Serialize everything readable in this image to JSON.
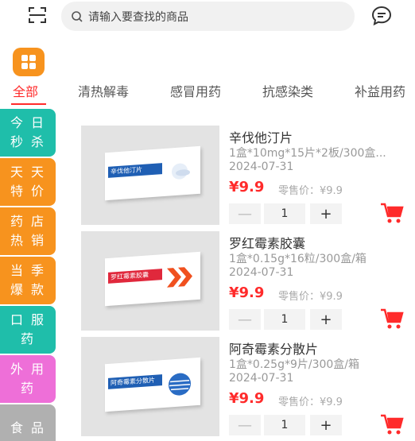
{
  "search": {
    "placeholder": "请输入要查找的商品"
  },
  "tabs": [
    {
      "label": "全部",
      "active": true
    },
    {
      "label": "清热解毒"
    },
    {
      "label": "感冒用药"
    },
    {
      "label": "抗感染类"
    },
    {
      "label": "补益用药"
    }
  ],
  "sidebar": [
    {
      "label": "今日秒杀",
      "color": "#1fbeaa"
    },
    {
      "label": "天天特价",
      "color": "#f7931e"
    },
    {
      "label": "药店热销",
      "color": "#f7931e"
    },
    {
      "label": "当季爆款",
      "color": "#f7931e"
    },
    {
      "label": "口服药",
      "color": "#1fbeaa"
    },
    {
      "label": "外用药",
      "color": "#ee6fd8"
    },
    {
      "label": "食品",
      "color": "#b0b0b0"
    }
  ],
  "products": [
    {
      "name": "辛伐他汀片",
      "spec": "1盒*10mg*15片*2板/300盒...",
      "date": "2024-07-31",
      "price": "¥9.9",
      "retail": "零售价：¥9.9",
      "qty": "1",
      "box_label": "辛伐他汀片",
      "box_color": "#1f5fb4"
    },
    {
      "name": "罗红霉素胶囊",
      "spec": "1盒*0.15g*16粒/300盒/箱",
      "date": "2024-07-31",
      "price": "¥9.9",
      "retail": "零售价：¥9.9",
      "qty": "1",
      "box_label": "罗红霉素胶囊",
      "box_color": "#e0283c"
    },
    {
      "name": "阿奇霉素分散片",
      "spec": "1盒*0.25g*9片/300盒/箱",
      "date": "2024-07-31",
      "price": "¥9.9",
      "retail": "零售价：¥9.9",
      "qty": "1",
      "box_label": "阿奇霉素分散片",
      "box_color": "#1f5fb4"
    }
  ],
  "colors": {
    "accent": "#ff2b2b",
    "category_icon": "#f7931e"
  },
  "icons": {
    "scan": "scan-icon",
    "search": "search-icon",
    "message": "message-icon",
    "category": "grid-icon",
    "cart": "cart-icon"
  }
}
